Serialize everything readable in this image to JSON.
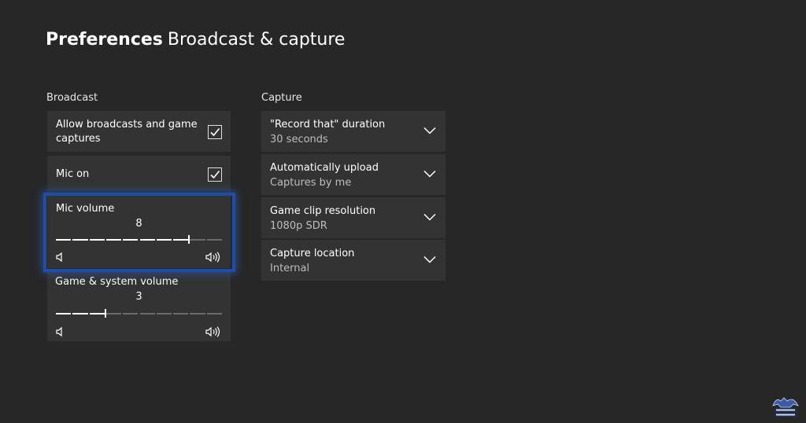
{
  "header": {
    "title_bold": "Preferences",
    "title_light": "Broadcast & capture"
  },
  "broadcast": {
    "label": "Broadcast",
    "allow": {
      "label_line1": "Allow broadcasts and game",
      "label_line2": "captures",
      "checked": true
    },
    "mic_on": {
      "label": "Mic on",
      "checked": true
    },
    "mic_volume": {
      "label": "Mic volume",
      "value": "8",
      "level": 8,
      "max": 10
    },
    "game_volume": {
      "label": "Game & system volume",
      "value": "3",
      "level": 3,
      "max": 10
    }
  },
  "capture": {
    "label": "Capture",
    "items": [
      {
        "label": "\"Record that\" duration",
        "value": "30 seconds"
      },
      {
        "label": "Automatically upload",
        "value": "Captures by me"
      },
      {
        "label": "Game clip resolution",
        "value": "1080p SDR"
      },
      {
        "label": "Capture location",
        "value": "Internal"
      }
    ]
  },
  "colors": {
    "background": "#272727",
    "tile": "#333333",
    "focus": "#1f4ea8",
    "track_filled": "#ffffff",
    "track_empty": "#6b6b6b"
  },
  "icons": {
    "checkbox": "checkmark-icon",
    "dropdown": "chevron-down-icon",
    "vol_low": "speaker-low-icon",
    "vol_high": "speaker-high-icon",
    "watermark": "logo-icon"
  }
}
